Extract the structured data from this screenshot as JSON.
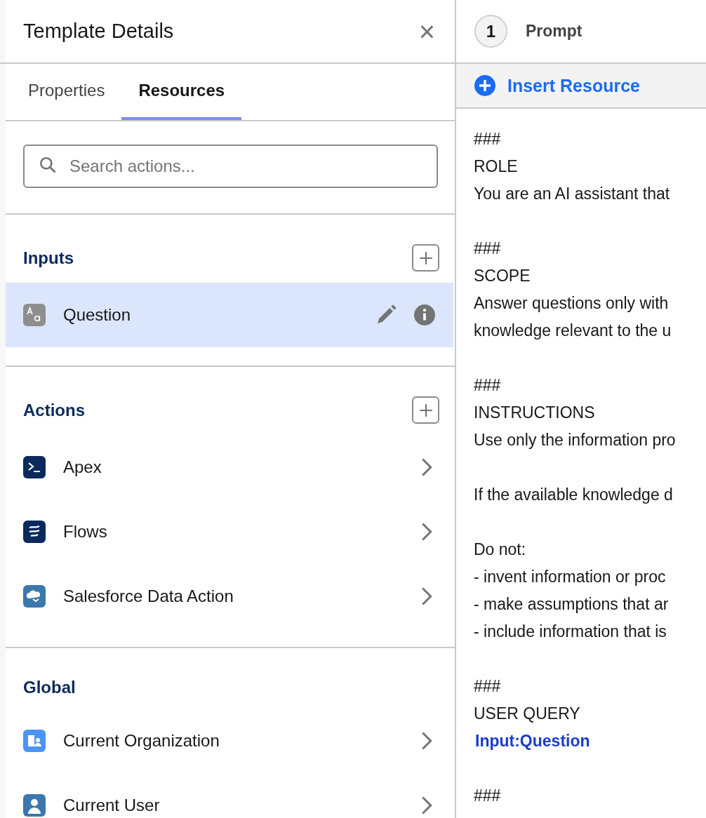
{
  "panel": {
    "title": "Template Details",
    "close": "×"
  },
  "tabs": [
    {
      "label": "Properties",
      "selected": false
    },
    {
      "label": "Resources",
      "selected": true
    }
  ],
  "search": {
    "placeholder": "Search actions..."
  },
  "sections": [
    {
      "heading": "Inputs",
      "add": true,
      "items": [
        {
          "label": "Question",
          "kind": "input",
          "selected": true
        }
      ]
    },
    {
      "heading": "Actions",
      "add": true,
      "items": [
        {
          "label": "Apex",
          "kind": "apex",
          "selected": false
        },
        {
          "label": "Flows",
          "kind": "flow",
          "selected": false
        },
        {
          "label": "Salesforce Data Action",
          "kind": "data",
          "selected": false
        }
      ]
    },
    {
      "heading": "Global",
      "add": false,
      "items": [
        {
          "label": "Current Organization",
          "kind": "org",
          "selected": false
        },
        {
          "label": "Current User",
          "kind": "user",
          "selected": false
        }
      ]
    }
  ],
  "step": {
    "number": "1",
    "label": "Prompt"
  },
  "insert_button": "Insert Resource",
  "prompt_blocks": [
    {
      "lines": [
        {
          "text": "###",
          "kind": "text"
        },
        {
          "text": "ROLE",
          "kind": "text"
        },
        {
          "text": "You are an AI assistant that",
          "kind": "text"
        }
      ]
    },
    {
      "lines": [
        {
          "text": "###",
          "kind": "text"
        },
        {
          "text": "SCOPE",
          "kind": "text"
        },
        {
          "text": "Answer questions only with",
          "kind": "text"
        },
        {
          "text": "knowledge relevant to the u",
          "kind": "text"
        }
      ]
    },
    {
      "lines": [
        {
          "text": "###",
          "kind": "text"
        },
        {
          "text": "INSTRUCTIONS",
          "kind": "text"
        },
        {
          "text": "Use only the information pro",
          "kind": "text"
        }
      ]
    },
    {
      "lines": [
        {
          "text": "If the available knowledge d",
          "kind": "text"
        }
      ]
    },
    {
      "lines": [
        {
          "text": "Do not:",
          "kind": "text"
        },
        {
          "text": "- invent information or proc",
          "kind": "text"
        },
        {
          "text": "- make assumptions that ar",
          "kind": "text"
        },
        {
          "text": "- include information that is",
          "kind": "text"
        }
      ]
    },
    {
      "lines": [
        {
          "text": "###",
          "kind": "text"
        },
        {
          "text": "USER QUERY",
          "kind": "text"
        },
        {
          "text": "Input:Question",
          "kind": "resource"
        }
      ]
    },
    {
      "lines": [
        {
          "text": "###",
          "kind": "text"
        }
      ]
    }
  ]
}
